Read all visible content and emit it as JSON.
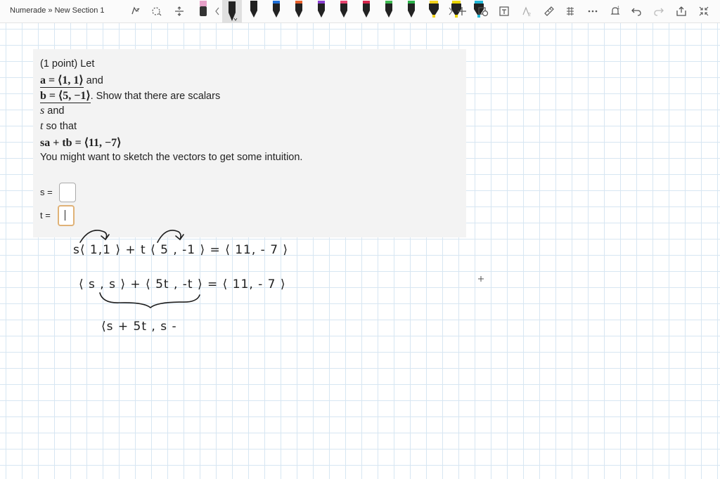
{
  "breadcrumb": "Numerade » New Section 1",
  "toolbar": {
    "icons": [
      "lasso-select-icon",
      "add-space-icon",
      "eraser-icon",
      "pen-icon",
      "highlighter-icon",
      "add-pen-icon",
      "ink-to-shape-icon",
      "ink-to-text-icon",
      "ink-to-math-icon",
      "ruler-icon",
      "insert-space-icon",
      "more-icon",
      "bell-icon",
      "undo-icon",
      "redo-icon",
      "share-icon",
      "fullscreen-icon"
    ],
    "pen_colors": [
      "#222222",
      "#222222",
      "#1f6fd8",
      "#e8612c",
      "#8a3fd1",
      "#e8426e",
      "#d6264c",
      "#3fb950",
      "#2bb34a",
      "#f2d21b",
      "#e9d400",
      "#1fb6d6"
    ],
    "selected_pen_color": "#222222"
  },
  "problem": {
    "line1": "(1 point) Let",
    "a_def": "a = ⟨1, 1⟩",
    "and1": " and",
    "b_def": "b = ⟨5, −1⟩",
    "show": ". Show that there are scalars",
    "s_var": "s",
    "and2": " and",
    "t_var": "t",
    "so_that": " so that",
    "equation": "sa + tb = ⟨11, −7⟩",
    "hint": "You might want to sketch the vectors to get some intuition.",
    "s_label": "s =",
    "t_label": "t =",
    "s_value": "",
    "t_value": ""
  },
  "handwriting": {
    "line1": "s⟨ 1,1 ⟩ + t ⟨ 5 , -1 ⟩ = ⟨ 11, - 7 ⟩",
    "line2": "⟨ s , s ⟩ + ⟨ 5t , -t ⟩ = ⟨ 11, - 7 ⟩",
    "line3": "⟨s + 5t , s -"
  }
}
